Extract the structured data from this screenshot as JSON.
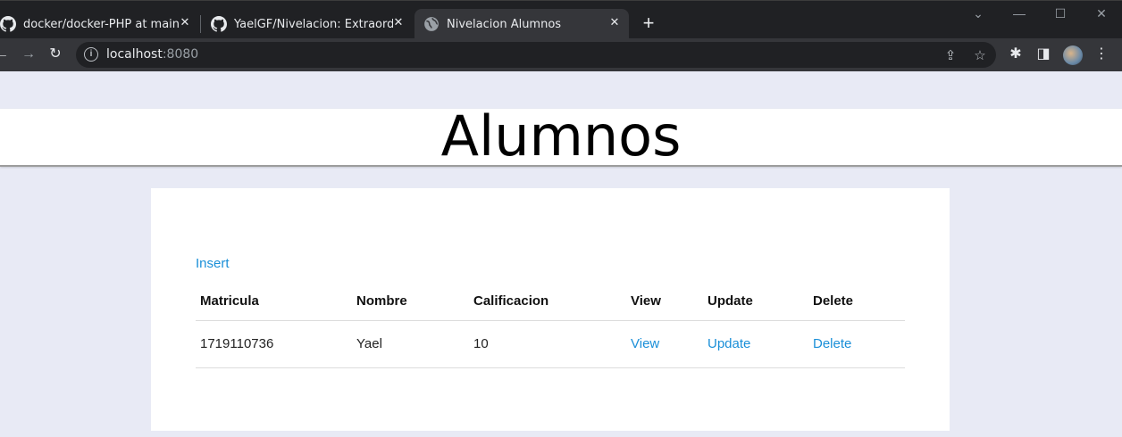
{
  "browser": {
    "tabs": [
      {
        "title": "docker/docker-PHP at main · Yae",
        "icon": "github-icon"
      },
      {
        "title": "YaelGF/Nivelacion: Extraordinario",
        "icon": "github-icon"
      },
      {
        "title": "Nivelacion Alumnos",
        "icon": "globe-icon"
      }
    ],
    "address": {
      "host": "localhost",
      "port": ":8080"
    }
  },
  "page": {
    "title": "Alumnos",
    "insert_label": "Insert",
    "table": {
      "headers": [
        "Matricula",
        "Nombre",
        "Calificacion",
        "View",
        "Update",
        "Delete"
      ],
      "rows": [
        {
          "matricula": "1719110736",
          "nombre": "Yael",
          "calificacion": "10",
          "view": "View",
          "update": "Update",
          "delete": "Delete"
        }
      ]
    }
  },
  "colors": {
    "accent": "#1a8fd8",
    "background": "#e8eaf5"
  }
}
